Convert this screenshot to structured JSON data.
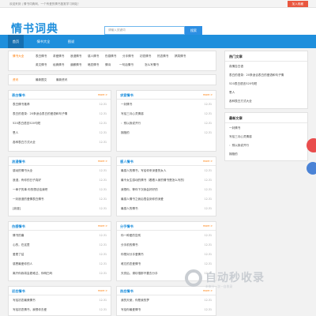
{
  "topbar": {
    "welcome": "欢迎来到 | 情书词典网，一个有爱的情书鉴赏学习网站！",
    "join": "加入收藏"
  },
  "header": {
    "logo": "情书词典",
    "search_placeholder": "请输入关键词",
    "search_button": "搜索"
  },
  "nav": {
    "items": [
      "首页",
      "情书大全",
      "图说"
    ]
  },
  "categories": {
    "title": "情书大全",
    "links": [
      "表白情书",
      "求爱情书",
      "浪漫情书",
      "感人情书",
      "伤感情书",
      "分手情书",
      "初恋情书",
      "热恋情书",
      "搞笑情书",
      "英文情书",
      "经典情书",
      "道歉情书",
      "暗恋情书",
      "情诗",
      "一句话情书",
      "怎么写情书"
    ]
  },
  "bar": {
    "title": "资讯",
    "tabs": [
      "最新图文",
      "最新资讯"
    ]
  },
  "panels": [
    {
      "title": "表白情书",
      "more": "more >",
      "rows": [
        {
          "text": "表白情书推荐",
          "date": "12-31"
        },
        {
          "text": "表白的语录：20条适合表白的爱语和句子情",
          "date": "12-31"
        },
        {
          "text": "520表白语言520句短",
          "date": "12-31"
        },
        {
          "text": "恩人",
          "date": "12-31"
        },
        {
          "text": "各种表白方式大全",
          "date": "12-31"
        }
      ]
    },
    {
      "title": "求爱情书",
      "more": "more >",
      "rows": [
        {
          "text": "一封情书",
          "date": "12-31"
        },
        {
          "text": "写给三月心灵情感",
          "date": "12-31"
        },
        {
          "text": "：别以我说开行",
          "date": "12-31"
        },
        {
          "text": "拥抱的",
          "date": "12-31"
        }
      ]
    },
    {
      "title": "浪漫情书",
      "more": "more >",
      "rows": [
        {
          "text": "感动的情书大全",
          "date": "12-31"
        },
        {
          "text": "浪漫，有你的日子真好",
          "date": "12-31"
        },
        {
          "text": "一辈子的事 你的想法给我吧",
          "date": "12-31"
        },
        {
          "text": "一封浪漫的爱情表白情书",
          "date": "12-31"
        },
        {
          "text": "[浪漫]",
          "date": "12-31"
        }
      ]
    },
    {
      "title": "感人情书",
      "more": "more >",
      "rows": [
        {
          "text": "最感人的情书，写给你来深爱的女人",
          "date": "12-31"
        },
        {
          "text": "最令女生感动的情书（看看人家的情书是怎么写的）",
          "date": "12-31"
        },
        {
          "text": "我想你，等你下次我会好好的",
          "date": "12-31"
        },
        {
          "text": "最感人情书之我后悟会到你的深爱",
          "date": "12-31"
        },
        {
          "text": "最感人的情书",
          "date": "12-31"
        }
      ]
    },
    {
      "title": "伤感情书",
      "more": "more >",
      "rows": [
        {
          "text": "情书的痛",
          "date": "12-31"
        },
        {
          "text": "心的，在这里",
          "date": "12-31"
        },
        {
          "text": "爱是了结",
          "date": "12-31"
        },
        {
          "text": "感恩最爱你的人",
          "date": "12-31"
        },
        {
          "text": "离开你我将会更难过、你明白吗",
          "date": "12-31"
        }
      ]
    },
    {
      "title": "分手情书",
      "more": "more >",
      "rows": [
        {
          "text": "你一种爱的告别",
          "date": "12-31"
        },
        {
          "text": "分手前的情书",
          "date": "12-31"
        },
        {
          "text": "你想对分手爱情书",
          "date": "12-31"
        },
        {
          "text": "难忘的恋爱情书",
          "date": "12-31"
        },
        {
          "text": "天亮后，请珍惜那不要去分手",
          "date": "12-31"
        }
      ]
    },
    {
      "title": "初恋情书",
      "more": "more >",
      "rows": [
        {
          "text": "写给初恋最美情书",
          "date": "12-31"
        },
        {
          "text": "写给初恋情书，我想你去爱",
          "date": "12-31"
        }
      ]
    },
    {
      "title": "热恋情书",
      "more": "more >",
      "rows": [
        {
          "text": "我的天使，你是我的梦",
          "date": "12-31"
        },
        {
          "text": "写给你最爱情书",
          "date": "12-31"
        }
      ]
    }
  ],
  "sidebar": [
    {
      "title": "热门文章",
      "items": [
        "真情告白语",
        "表白的语录：20条适合表白的爱语和句子情",
        "520表白语言520句短",
        "恩人",
        "各种表白方式大全"
      ]
    },
    {
      "title": "最新文章",
      "items": [
        "一封情书",
        "写给三月心灵情感",
        "：别以我说开行",
        "拥抱的"
      ]
    }
  ],
  "watermark": {
    "text": "自动秒收录",
    "sub": "未来分一次一自收录"
  },
  "colors": {
    "brand": "#1f8fdc",
    "accent": "#ff7a00",
    "join": "#e9573f"
  }
}
